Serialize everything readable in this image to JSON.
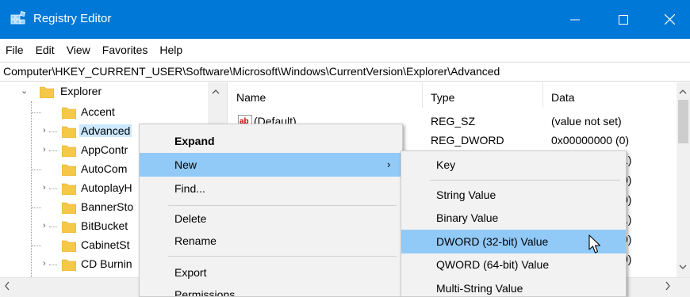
{
  "window": {
    "title": "Registry Editor",
    "accent": "#0078d7",
    "icon": "registry-icon"
  },
  "menubar": [
    "File",
    "Edit",
    "View",
    "Favorites",
    "Help"
  ],
  "address": "Computer\\HKEY_CURRENT_USER\\Software\\Microsoft\\Windows\\CurrentVersion\\Explorer\\Advanced",
  "tree": {
    "items": [
      {
        "label": "Explorer"
      },
      {
        "label": "Accent"
      },
      {
        "label": "Advanced"
      },
      {
        "label": "AppContr"
      },
      {
        "label": "AutoCom"
      },
      {
        "label": "AutoplayH"
      },
      {
        "label": "BannerSto"
      },
      {
        "label": "BitBucket"
      },
      {
        "label": "CabinetSt"
      },
      {
        "label": "CD Burnin"
      }
    ]
  },
  "values": {
    "columns": {
      "name": "Name",
      "type": "Type",
      "data": "Data"
    },
    "rows": [
      {
        "name": "(Default)",
        "type": "REG_SZ",
        "data": "(value not set)"
      },
      {
        "name": "",
        "type": "REG_DWORD",
        "data": "0x00000000 (0)"
      },
      {
        "name": "",
        "type": "",
        "data": "1)"
      },
      {
        "name": "",
        "type": "",
        "data": "0)"
      },
      {
        "name": "",
        "type": "",
        "data": "0)"
      },
      {
        "name": "",
        "type": "",
        "data": "1)"
      },
      {
        "name": "",
        "type": "",
        "data": "0)"
      },
      {
        "name": "",
        "type": "",
        "data": "0)"
      }
    ],
    "string_icon_text": "ab"
  },
  "context_menu": {
    "expand": "Expand",
    "new": "New",
    "find": "Find...",
    "delete": "Delete",
    "rename": "Rename",
    "export": "Export",
    "permissions": "Permissions",
    "submenu_arrow": "›"
  },
  "submenu": {
    "key": "Key",
    "string_value": "String Value",
    "binary_value": "Binary Value",
    "dword_value": "DWORD (32-bit) Value",
    "qword_value": "QWORD (64-bit) Value",
    "multi_string_value": "Multi-String Value"
  }
}
